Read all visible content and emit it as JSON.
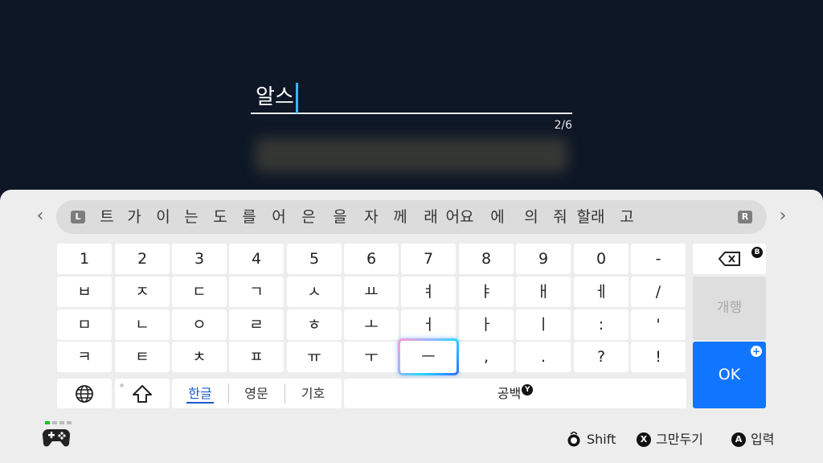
{
  "input": {
    "text": "알스",
    "count": "2/6"
  },
  "predictions": {
    "left_button": "L",
    "right_button": "R",
    "words": [
      "트",
      "가",
      "이",
      "는",
      "도",
      "를",
      "어",
      "은",
      "을",
      "자",
      "께",
      "래",
      "어요",
      "에",
      "의",
      "줘",
      "할래",
      "고"
    ]
  },
  "keyboard": {
    "rows": [
      [
        "1",
        "2",
        "3",
        "4",
        "5",
        "6",
        "7",
        "8",
        "9",
        "0",
        "-"
      ],
      [
        "ㅂ",
        "ㅈ",
        "ㄷ",
        "ㄱ",
        "ㅅ",
        "ㅛ",
        "ㅕ",
        "ㅑ",
        "ㅐ",
        "ㅔ",
        "/"
      ],
      [
        "ㅁ",
        "ㄴ",
        "ㅇ",
        "ㄹ",
        "ㅎ",
        "ㅗ",
        "ㅓ",
        "ㅏ",
        "ㅣ",
        ":",
        "'"
      ],
      [
        "ㅋ",
        "ㅌ",
        "ㅊ",
        "ㅍ",
        "ㅠ",
        "ㅜ",
        "ㅡ",
        ",",
        ".",
        "?",
        "!"
      ]
    ],
    "backspace_badge": "B",
    "newline_label": "개행",
    "ok_label": "OK",
    "ok_badge": "+",
    "modes": {
      "hangul": "한글",
      "english": "영문",
      "symbols": "기호"
    },
    "space_label": "공백",
    "space_badge": "Y"
  },
  "footer": {
    "shift_label": "Shift",
    "cancel_button": "X",
    "cancel_label": "그만두기",
    "enter_button": "A",
    "enter_label": "입력"
  }
}
